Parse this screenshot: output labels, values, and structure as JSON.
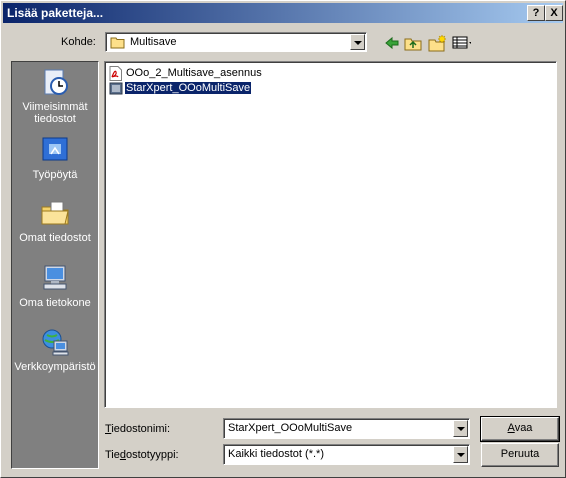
{
  "window": {
    "title": "Lisää paketteja..."
  },
  "titlebar_buttons": {
    "help": "?",
    "close": "X"
  },
  "toolbar": {
    "look_in_label": "Kohde:",
    "look_in_value": "Multisave",
    "icons": [
      "back-icon",
      "up-folder-icon",
      "new-folder-icon",
      "view-menu-icon"
    ]
  },
  "places": [
    {
      "label": "Viimeisimmät tiedostot",
      "icon": "recent-icon"
    },
    {
      "label": "Työpöytä",
      "icon": "desktop-icon"
    },
    {
      "label": "Omat tiedostot",
      "icon": "my-documents-icon"
    },
    {
      "label": "Oma tietokone",
      "icon": "my-computer-icon"
    },
    {
      "label": "Verkkoympäristö",
      "icon": "network-icon"
    }
  ],
  "files": [
    {
      "name": "OOo_2_Multisave_asennus",
      "icon": "pdf-icon",
      "selected": false
    },
    {
      "name": "StarXpert_OOoMultiSave",
      "icon": "package-icon",
      "selected": true
    }
  ],
  "footer": {
    "filename_label": "Tiedostonimi:",
    "filename_value": "StarXpert_OOoMultiSave",
    "filetype_label": "Tiedostotyyppi:",
    "filetype_value": "Kaikki tiedostot (*.*)",
    "open_button": "Avaa",
    "cancel_button": "Peruuta"
  }
}
